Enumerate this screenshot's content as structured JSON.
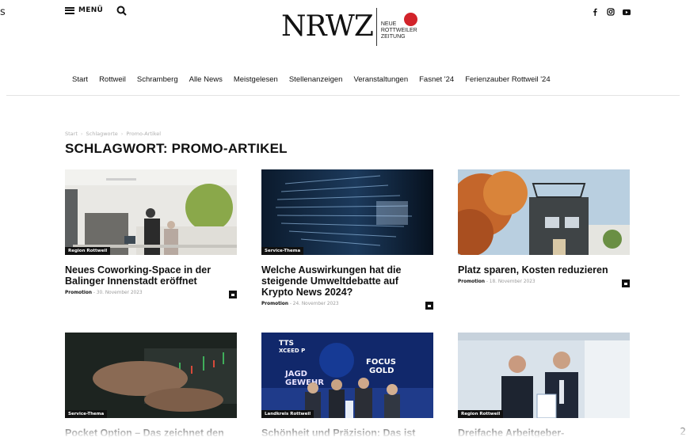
{
  "edge": {
    "left_text": "s",
    "right_text": "2"
  },
  "header": {
    "menu_label": "MENÜ",
    "logo_main": "NRWZ",
    "logo_sub": [
      "NEUE",
      "ROTTWEILER",
      "ZEITUNG"
    ],
    "social": [
      "facebook-icon",
      "instagram-icon",
      "youtube-icon"
    ],
    "brand_color": "#d2232a"
  },
  "nav": {
    "items": [
      "Start",
      "Rottweil",
      "Schramberg",
      "Alle News",
      "Meistgelesen",
      "Stellenanzeigen",
      "Veranstaltungen",
      "Fasnet '24",
      "Ferienzauber Rottweil '24"
    ]
  },
  "breadcrumb": [
    "Start",
    "Schlagworte",
    "Promo-Artikel"
  ],
  "page_title": "SCHLAGWORT: PROMO-ARTIKEL",
  "articles": [
    {
      "category": "Region Rottweil",
      "title": "Neues Coworking-Space in der Balinger Innenstadt eröffnet",
      "author": "Promotion",
      "date": "30. November 2023"
    },
    {
      "category": "Service-Thema",
      "title": "Welche Auswirkungen hat die steigende Umweltdebatte auf Krypto News 2024?",
      "author": "Promotion",
      "date": "24. November 2023"
    },
    {
      "category": "",
      "title": "Platz sparen, Kosten reduzieren",
      "author": "Promotion",
      "date": "18. November 2023"
    },
    {
      "category": "Service-Thema",
      "title": "Pocket Option – Das zeichnet den Broker aus",
      "author": "",
      "date": ""
    },
    {
      "category": "Landkreis Rottweil",
      "title": "Schönheit und Präzision: Das ist es, die Sie bei TTS",
      "author": "",
      "date": "",
      "image_text": [
        "TTS",
        "XCEED P",
        "JAGD",
        "GEWEHR",
        "FOCUS",
        "GOLD"
      ]
    },
    {
      "category": "Region Rottweil",
      "title": "Dreifache Arbeitgeber-Auszeichnung für Kollektiv",
      "author": "",
      "date": ""
    }
  ]
}
